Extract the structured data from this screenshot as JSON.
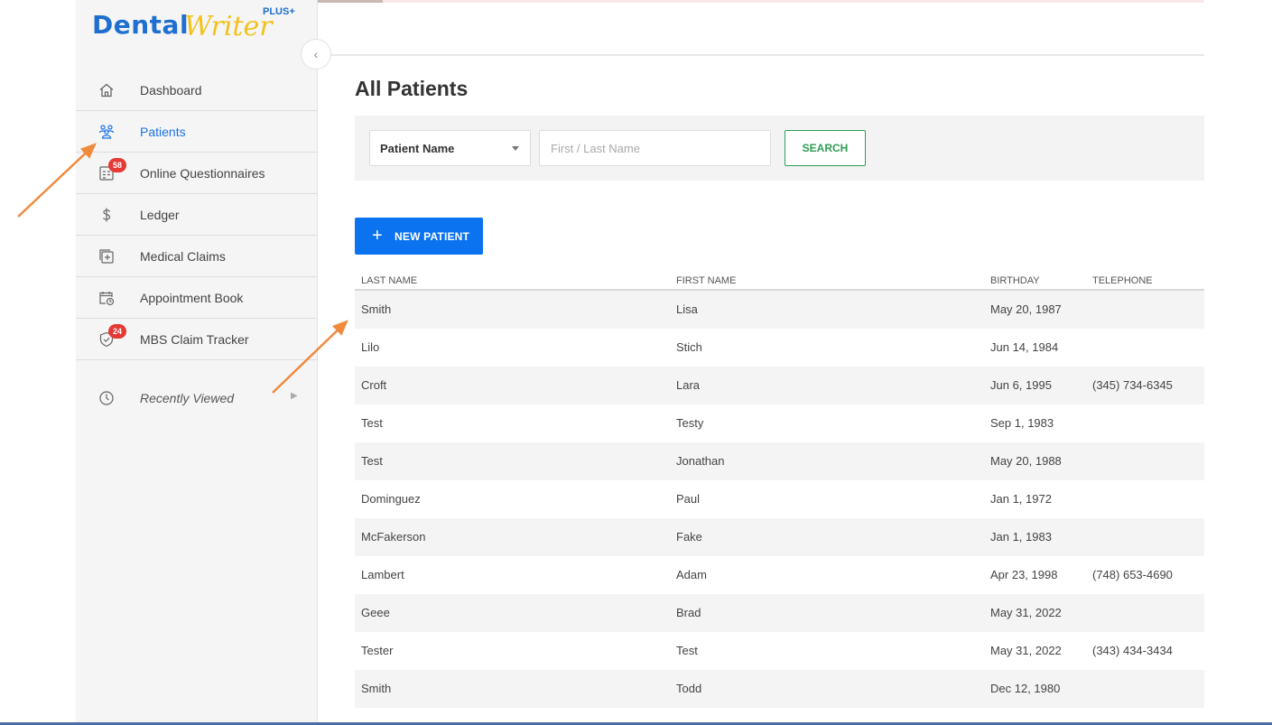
{
  "brand": {
    "name_part1": "Dental",
    "name_part2": "Writer",
    "tier": "PLUS+"
  },
  "colors": {
    "accent": "#1a73e8",
    "primary_button": "#0b73f0",
    "search_button": "#2e9d55",
    "badge": "#e53935",
    "annotation_arrow": "#f08a3c"
  },
  "sidebar": {
    "items": [
      {
        "label": "Dashboard",
        "icon": "home-icon"
      },
      {
        "label": "Patients",
        "icon": "users-icon",
        "active": true
      },
      {
        "label": "Online Questionnaires",
        "icon": "checklist-icon",
        "badge": "58"
      },
      {
        "label": "Ledger",
        "icon": "dollar-icon"
      },
      {
        "label": "Medical Claims",
        "icon": "medical-claim-icon"
      },
      {
        "label": "Appointment Book",
        "icon": "calendar-clock-icon"
      },
      {
        "label": "MBS Claim Tracker",
        "icon": "shield-check-icon",
        "badge": "24"
      }
    ],
    "recently_viewed": "Recently Viewed"
  },
  "main": {
    "title": "All Patients",
    "search": {
      "field_select": "Patient Name",
      "placeholder": "First / Last Name",
      "value": "",
      "button": "SEARCH"
    },
    "new_patient_button": "NEW PATIENT",
    "table": {
      "headers": [
        "LAST NAME",
        "FIRST NAME",
        "BIRTHDAY",
        "TELEPHONE"
      ],
      "rows": [
        [
          "Smith",
          "Lisa",
          "May 20, 1987",
          ""
        ],
        [
          "Lilo",
          "Stich",
          "Jun 14, 1984",
          ""
        ],
        [
          "Croft",
          "Lara",
          "Jun 6, 1995",
          "(345) 734-6345"
        ],
        [
          "Test",
          "Testy",
          "Sep 1, 1983",
          ""
        ],
        [
          "Test",
          "Jonathan",
          "May 20, 1988",
          ""
        ],
        [
          "Dominguez",
          "Paul",
          "Jan 1, 1972",
          ""
        ],
        [
          "McFakerson",
          "Fake",
          "Jan 1, 1983",
          ""
        ],
        [
          "Lambert",
          "Adam",
          "Apr 23, 1998",
          "(748) 653-4690"
        ],
        [
          "Geee",
          "Brad",
          "May 31, 2022",
          ""
        ],
        [
          "Tester",
          "Test",
          "May 31, 2022",
          "(343) 434-3434"
        ],
        [
          "Smith",
          "Todd",
          "Dec 12, 1980",
          ""
        ]
      ]
    }
  }
}
